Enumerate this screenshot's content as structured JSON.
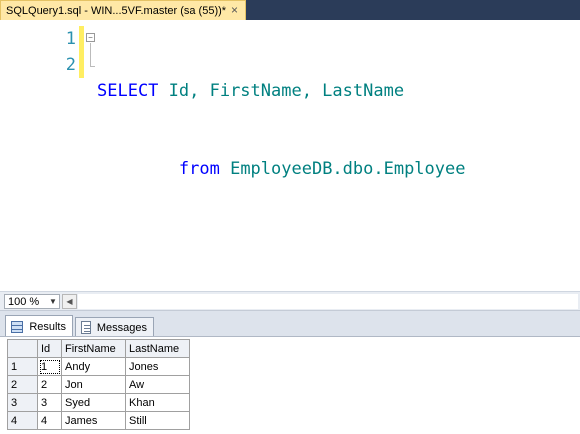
{
  "tab": {
    "title": "SQLQuery1.sql - WIN...5VF.master (sa (55))*",
    "close_glyph": "×"
  },
  "editor": {
    "line_numbers": [
      "1",
      "2"
    ],
    "lines": [
      {
        "keyword": "SELECT",
        "rest": " Id, FirstName, LastName"
      },
      {
        "indent": "        ",
        "keyword": "from",
        "rest": " EmployeeDB.dbo.Employee"
      }
    ],
    "colors": {
      "keyword": "#0000ff",
      "identifier": "#008080",
      "line_number": "#2b91af"
    }
  },
  "zoom": {
    "value": "100 %"
  },
  "results_tabs": {
    "results_label": "Results",
    "messages_label": "Messages"
  },
  "results": {
    "columns": [
      "Id",
      "FirstName",
      "LastName"
    ],
    "rows": [
      {
        "row_num": "1",
        "id": "1",
        "first": "Andy",
        "last": "Jones"
      },
      {
        "row_num": "2",
        "id": "2",
        "first": "Jon",
        "last": "Aw"
      },
      {
        "row_num": "3",
        "id": "3",
        "first": "Syed",
        "last": "Khan"
      },
      {
        "row_num": "4",
        "id": "4",
        "first": "James",
        "last": "Still"
      }
    ]
  }
}
